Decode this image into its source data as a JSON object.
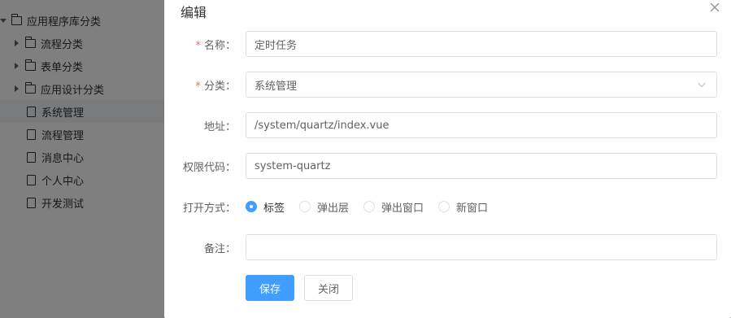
{
  "tree": {
    "root": {
      "label": "应用程序库分类"
    },
    "items": [
      {
        "label": "流程分类",
        "type": "folder"
      },
      {
        "label": "表单分类",
        "type": "folder"
      },
      {
        "label": "应用设计分类",
        "type": "folder"
      },
      {
        "label": "系统管理",
        "type": "doc",
        "selected": true
      },
      {
        "label": "流程管理",
        "type": "doc"
      },
      {
        "label": "消息中心",
        "type": "doc"
      },
      {
        "label": "个人中心",
        "type": "doc"
      },
      {
        "label": "开发测试",
        "type": "doc"
      }
    ]
  },
  "dialog": {
    "title": "编辑",
    "close_icon": "close-icon",
    "fields": {
      "name": {
        "label": "名称：",
        "required": true,
        "value": "定时任务"
      },
      "category": {
        "label": "分类：",
        "required": true,
        "value": "系统管理"
      },
      "address": {
        "label": "地址：",
        "value": "/system/quartz/index.vue"
      },
      "permission": {
        "label": "权限代码：",
        "value": "system-quartz"
      },
      "open_mode": {
        "label": "打开方式：",
        "options": [
          "标签",
          "弹出层",
          "弹出窗口",
          "新窗口"
        ],
        "selected": "标签"
      },
      "note": {
        "label": "备注：",
        "value": ""
      }
    },
    "buttons": {
      "save": "保存",
      "close": "关闭"
    }
  },
  "colors": {
    "primary": "#409eff",
    "required_star": "#f56c6c",
    "mask": "rgba(0,0,0,0.5)"
  }
}
